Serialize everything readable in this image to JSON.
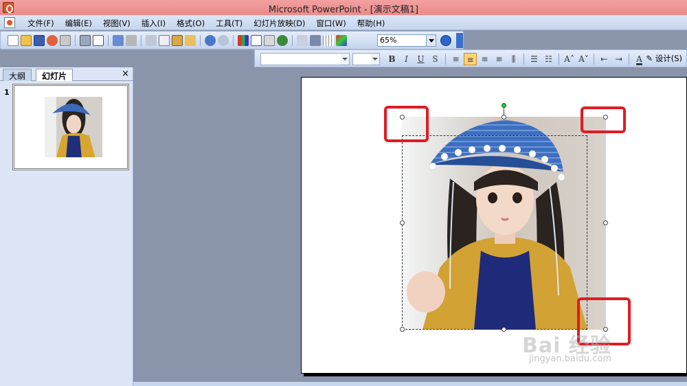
{
  "window": {
    "title": "Microsoft PowerPoint - [演示文稿1]"
  },
  "menu": {
    "items": [
      "文件(F)",
      "编辑(E)",
      "视图(V)",
      "插入(I)",
      "格式(O)",
      "工具(T)",
      "幻灯片放映(D)",
      "窗口(W)",
      "帮助(H)"
    ]
  },
  "toolbar": {
    "zoom_value": "65%",
    "icons": [
      "new-icon",
      "open-icon",
      "save-icon",
      "permission-icon",
      "email-icon",
      "print-icon",
      "print-preview-icon",
      "spelling-icon",
      "research-icon",
      "cut-icon",
      "copy-icon",
      "paste-icon",
      "format-painter-icon",
      "undo-icon",
      "redo-icon",
      "insert-chart-icon",
      "insert-table-icon",
      "tables-borders-icon",
      "insert-hyperlink-icon",
      "expand-icon",
      "show-formatting-icon",
      "grid-icon",
      "color-grayscale-icon"
    ]
  },
  "formatting": {
    "font_value": "",
    "size_value": "",
    "buttons": [
      "B",
      "I",
      "U",
      "S"
    ],
    "design_label": "设计(S)"
  },
  "left_pane": {
    "tabs": [
      "大纲",
      "幻灯片"
    ],
    "active_tab": "幻灯片",
    "close_glyph": "×",
    "slide_number": "1"
  },
  "watermark": {
    "brand": "Bai 经验",
    "url": "jingyan.baidu.com"
  },
  "colors": {
    "title_bar": "#e98b8b",
    "workspace": "#8a95ac",
    "highlight": "#e01b24",
    "rotate_handle": "#2cc24a"
  }
}
